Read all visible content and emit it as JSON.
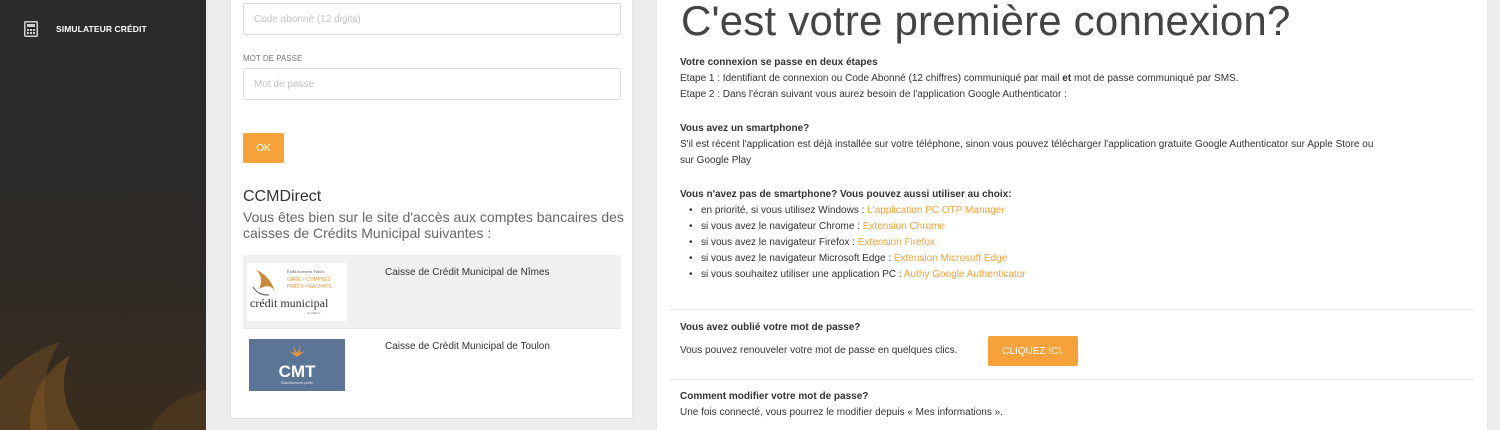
{
  "sidebar": {
    "items": [
      {
        "label": "SIMULATEUR CRÉDIT",
        "icon": "calculator-icon"
      }
    ]
  },
  "login": {
    "subscriber_placeholder": "Code abonné (12 digits)",
    "password_label": "MOT DE PASSE",
    "password_placeholder": "Mot de passe",
    "ok_label": "OK"
  },
  "brand": {
    "title": "CCMDirect",
    "description": "Vous êtes bien sur le site d'accès aux comptes bancaires des caisses de Crédits Municipal suivantes :"
  },
  "banks": [
    {
      "name": "Caisse de Crédit Municipal de Nîmes",
      "logo_lines": [
        "Établissement Public",
        "GAGE • COMPTES",
        "PRÊTS • RACHATS",
        "crédit municipal",
        "de Nîmes"
      ]
    },
    {
      "name": "Caisse de Crédit Municipal de Toulon",
      "logo_text": "CMT",
      "logo_sub": "Établissement public"
    }
  ],
  "info": {
    "title": "C'est votre première connexion?",
    "steps_heading": "Votre connexion se passe en deux étapes",
    "step1_a": "Etape 1 : Identifiant de connexion ou Code Abonné (12 chiffres) communiqué par mail ",
    "step1_and": "et",
    "step1_b": " mot de passe communiqué par SMS.",
    "step2": "Etape 2 : Dans l'écran suivant vous aurez besoin de l'application Google Authenticator :",
    "smartphone_heading": "Vous avez un smartphone?",
    "smartphone_line1": "S'il est récent l'application est déjà installée sur votre téléphone, sinon vous pouvez télécharger l'application gratuite Google Authenticator sur Apple Store ou",
    "smartphone_line2": "sur Google Play",
    "nophone_heading": "Vous n'avez pas de smartphone? Vous pouvez aussi utiliser au choix:",
    "options": [
      {
        "text": "en priorité, si vous utilisez Windows : ",
        "link": "L'application PC OTP Manager"
      },
      {
        "text": "si vous avez le navigateur Chrome : ",
        "link": "Extension Chrome"
      },
      {
        "text": "si vous avez le navigateur Firefox : ",
        "link": "Extension Firefox"
      },
      {
        "text": "si vous avez le navigateur Microsoft Edge : ",
        "link": "Extension Microsoft Edge"
      },
      {
        "text": "si vous souhaitez utiliser une application PC : ",
        "link": "Authy Google Authenticator"
      }
    ],
    "forgot_heading": "Vous avez oublié votre mot de passe?",
    "forgot_text": "Vous pouvez renouveler votre mot de passe en quelques clics.",
    "forgot_button": "CLIQUEZ ICI.",
    "modify_heading": "Comment modifier votre mot de passe?",
    "modify_text": "Une fois connecté, vous pourrez le modifier depuis « Mes informations »."
  },
  "colors": {
    "accent": "#f7a13a",
    "sidebar_bg": "#2b2b2b",
    "cmt_logo_bg": "#5b7596"
  }
}
